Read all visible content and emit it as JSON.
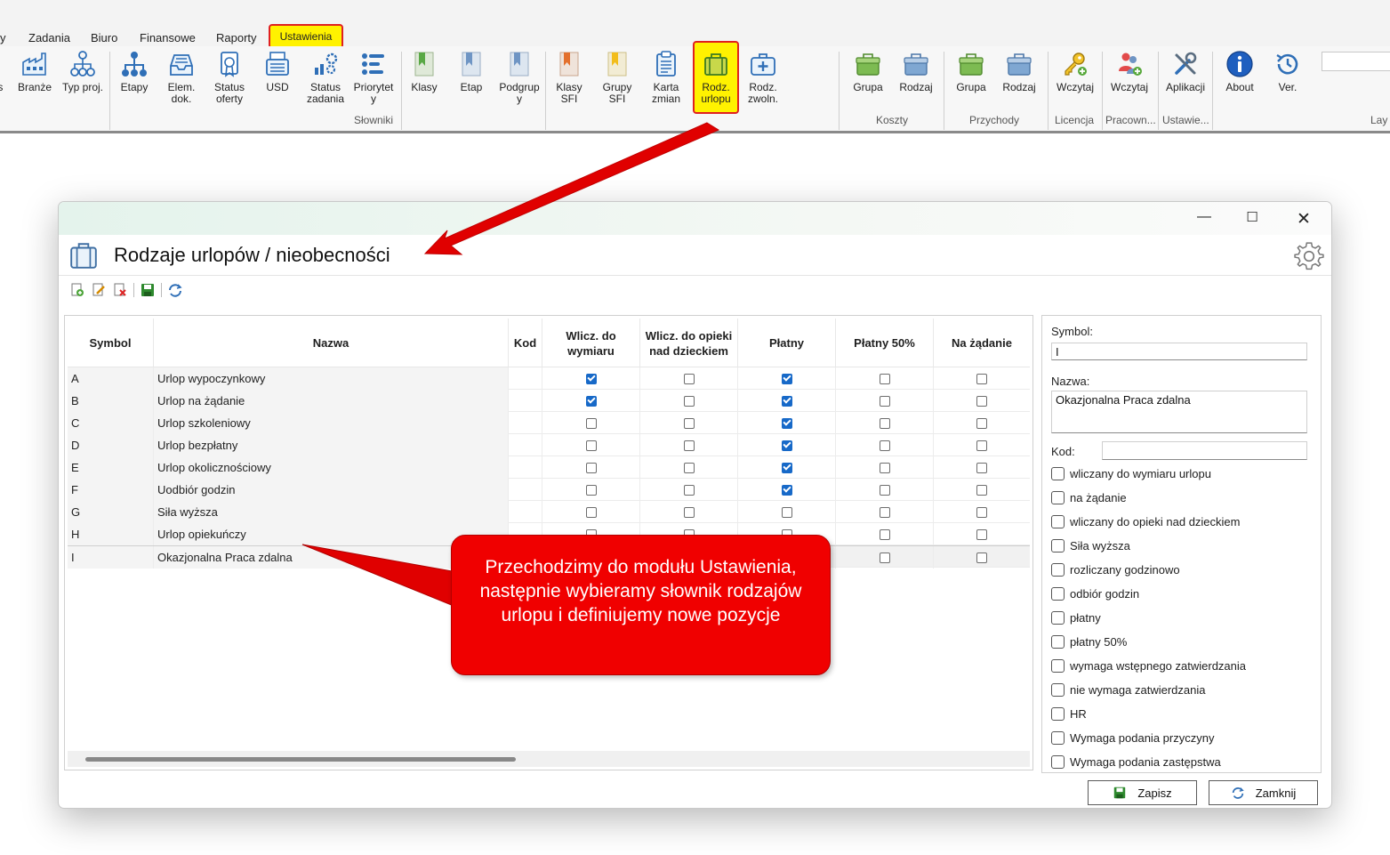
{
  "menu": {
    "items": [
      "y",
      "Zadania",
      "Biuro",
      "Finansowe",
      "Raporty"
    ],
    "active": "Ustawienia"
  },
  "ribbon": {
    "buttons": [
      {
        "label": "is",
        "icon": "partial-icon"
      },
      {
        "label": "Branże",
        "icon": "factory-icon"
      },
      {
        "label": "Typ proj.",
        "icon": "hierarchy-icon"
      },
      {
        "label": "Etapy",
        "icon": "org-chart-icon"
      },
      {
        "label": "Elem.\ndok.",
        "icon": "inbox-tray-icon"
      },
      {
        "label": "Status\noferty",
        "icon": "certificate-icon"
      },
      {
        "label": "USD",
        "icon": "cash-register-icon"
      },
      {
        "label": "Status\nzadania",
        "icon": "gears-chart-icon"
      },
      {
        "label": "Priorytet\ny",
        "icon": "priority-bars-icon"
      },
      {
        "label": "Klasy",
        "icon": "green-bookmark-icon"
      },
      {
        "label": "Etap",
        "icon": "blue-bookmark-icon"
      },
      {
        "label": "Podgrup\ny",
        "icon": "blue-bookmark-icon"
      },
      {
        "label": "Klasy\nSFI",
        "icon": "orange-bookmark-icon"
      },
      {
        "label": "Grupy\nSFI",
        "icon": "yellow-bookmark-icon"
      },
      {
        "label": "Karta\nzmian",
        "icon": "clipboard-list-icon"
      },
      {
        "label": "Rodz.\nurlopu",
        "icon": "suitcase-icon"
      },
      {
        "label": "Rodz.\nzwoln.",
        "icon": "medical-kit-icon"
      },
      {
        "label": "Grupa",
        "icon": "green-box-icon"
      },
      {
        "label": "Rodzaj",
        "icon": "blue-box-icon"
      },
      {
        "label": "Grupa",
        "icon": "green-box-icon"
      },
      {
        "label": "Rodzaj",
        "icon": "blue-box-icon"
      },
      {
        "label": "Wczytaj",
        "icon": "key-add-icon"
      },
      {
        "label": "Wczytaj",
        "icon": "users-add-icon"
      },
      {
        "label": "Aplikacji",
        "icon": "tools-icon"
      },
      {
        "label": "About",
        "icon": "info-icon"
      },
      {
        "label": "Ver.",
        "icon": "history-icon"
      }
    ],
    "groups": [
      "Słowniki",
      "Koszty",
      "Przychody",
      "Licencja",
      "Pracown...",
      "Ustawie...",
      "Lay"
    ]
  },
  "dialog": {
    "title": "Rodzaje urlopów / nieobecności",
    "columns": [
      "Symbol",
      "Nazwa",
      "Kod",
      "Wlicz. do wymiaru",
      "Wlicz. do opieki nad dzieckiem",
      "Płatny",
      "Płatny 50%",
      "Na żądanie"
    ],
    "rows": [
      {
        "symbol": "A",
        "nazwa": "Urlop wypoczynkowy",
        "kod": "",
        "checks": [
          true,
          false,
          true,
          false,
          false
        ]
      },
      {
        "symbol": "B",
        "nazwa": "Urlop na żądanie",
        "kod": "",
        "checks": [
          true,
          false,
          true,
          false,
          false
        ]
      },
      {
        "symbol": "C",
        "nazwa": "Urlop szkoleniowy",
        "kod": "",
        "checks": [
          false,
          false,
          true,
          false,
          false
        ]
      },
      {
        "symbol": "D",
        "nazwa": "Urlop bezpłatny",
        "kod": "",
        "checks": [
          false,
          false,
          true,
          false,
          false
        ]
      },
      {
        "symbol": "E",
        "nazwa": "Urlop okolicznościowy",
        "kod": "",
        "checks": [
          false,
          false,
          true,
          false,
          false
        ]
      },
      {
        "symbol": "F",
        "nazwa": "Uodbiór godzin",
        "kod": "",
        "checks": [
          false,
          false,
          true,
          false,
          false
        ]
      },
      {
        "symbol": "G",
        "nazwa": "Siła wyższa",
        "kod": "",
        "checks": [
          false,
          false,
          false,
          false,
          false
        ]
      },
      {
        "symbol": "H",
        "nazwa": "Urlop opiekuńczy",
        "kod": "",
        "checks": [
          false,
          false,
          false,
          false,
          false
        ]
      },
      {
        "symbol": "I",
        "nazwa": "Okazjonalna Praca zdalna",
        "kod": "",
        "checks": [
          false,
          false,
          false,
          false,
          false
        ]
      }
    ],
    "form": {
      "symbol_label": "Symbol:",
      "symbol_value": "I",
      "nazwa_label": "Nazwa:",
      "nazwa_value": "Okazjonalna Praca zdalna",
      "kod_label": "Kod:",
      "kod_value": "",
      "options": [
        "wliczany do wymiaru urlopu",
        "na żądanie",
        "wliczany do opieki nad dzieckiem",
        "Siła wyższa",
        "rozliczany godzinowo",
        "odbiór godzin",
        "płatny",
        "płatny 50%",
        "wymaga wstępnego zatwierdzania",
        "nie wymaga zatwierdzania",
        "HR",
        "Wymaga podania przyczyny",
        "Wymaga podania zastępstwa"
      ]
    },
    "save_label": "Zapisz",
    "close_label": "Zamknij"
  },
  "callout": {
    "text": "Przechodzimy do modułu Ustawienia, następnie wybieramy słownik rodzajów urlopu i definiujemy nowe pozycje"
  },
  "colors": {
    "highlight": "#fff200",
    "highlight_border": "#e02020",
    "callout": "#f00000",
    "check": "#1769c8"
  }
}
